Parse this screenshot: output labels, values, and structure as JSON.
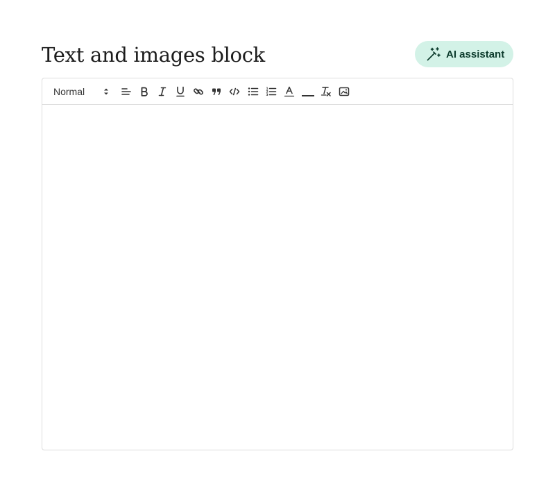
{
  "block": {
    "title": "Text and images block"
  },
  "ai_button": {
    "label": "AI assistant",
    "icon": "magic-wand-icon",
    "background": "#d3f2e7",
    "text_color": "#0c3b2c"
  },
  "editor": {
    "format_select": {
      "value": "Normal"
    },
    "toolbar_buttons": [
      {
        "name": "align",
        "icon": "align-left-icon"
      },
      {
        "name": "bold",
        "icon": "bold-icon"
      },
      {
        "name": "italic",
        "icon": "italic-icon"
      },
      {
        "name": "underline",
        "icon": "underline-icon"
      },
      {
        "name": "link",
        "icon": "link-icon"
      },
      {
        "name": "blockquote",
        "icon": "quote-icon"
      },
      {
        "name": "code",
        "icon": "code-icon"
      },
      {
        "name": "bullet-list",
        "icon": "bullet-list-icon"
      },
      {
        "name": "ordered-list",
        "icon": "numbered-list-icon"
      },
      {
        "name": "text-color",
        "icon": "text-color-icon"
      },
      {
        "name": "background-color",
        "icon": "highlight-color-icon"
      },
      {
        "name": "clear-format",
        "icon": "clear-format-icon"
      },
      {
        "name": "image",
        "icon": "image-icon"
      }
    ],
    "content": ""
  }
}
